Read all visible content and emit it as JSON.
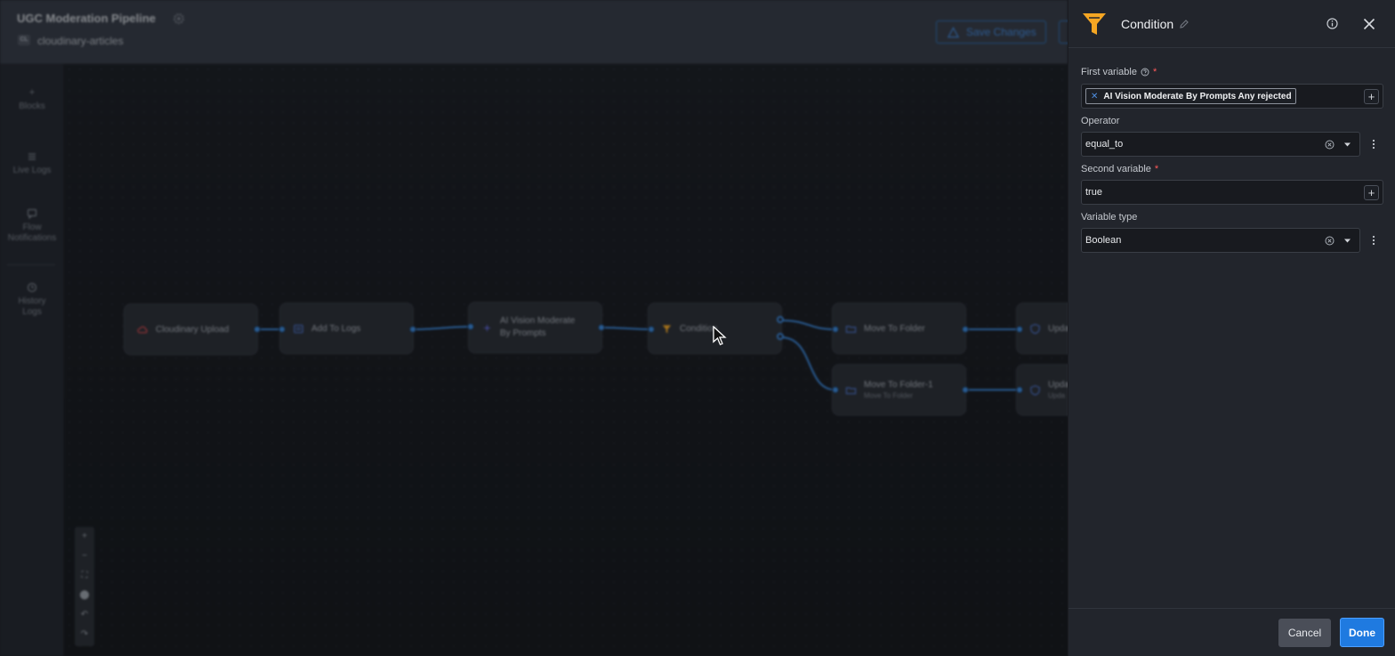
{
  "app": {
    "pipeline_title": "UGC Moderation Pipeline",
    "repo_badge": "CL",
    "repo_name": "cloudinary-articles",
    "save_changes_label": "Save Changes"
  },
  "leftnav": {
    "items": [
      {
        "label": "Blocks",
        "icon": "plus-icon"
      },
      {
        "label": "Live Logs",
        "icon": "list-icon"
      },
      {
        "label": "Flow Notifications",
        "icon": "message-icon"
      },
      {
        "label": "History Logs",
        "icon": "history-icon"
      }
    ]
  },
  "canvas": {
    "nodes": [
      {
        "title": "Cloudinary Upload",
        "sub": "",
        "icon": "cloud-icon"
      },
      {
        "title": "Add To Logs",
        "sub": "",
        "icon": "log-icon"
      },
      {
        "title": "AI Vision Moderate By Prompts",
        "sub": "",
        "icon": "sparkle-icon"
      },
      {
        "title": "Condition",
        "sub": "",
        "icon": "funnel-icon"
      },
      {
        "title": "Move To Folder",
        "sub": "",
        "icon": "folder-icon"
      },
      {
        "title": "Move To Folder-1",
        "sub": "Move To Folder",
        "icon": "folder-icon"
      },
      {
        "title": "Upda",
        "sub": "",
        "icon": "shield-icon"
      },
      {
        "title": "Upda",
        "sub": "Upda",
        "icon": "shield-icon"
      }
    ],
    "zoom_controls": [
      "+",
      "−",
      "⛶",
      "⬤",
      "↶",
      "↷"
    ]
  },
  "panel": {
    "title": "Condition",
    "first_variable": {
      "label": "First variable",
      "chip_text": "AI Vision Moderate By Prompts  Any rejected",
      "add_label": "+"
    },
    "operator": {
      "label": "Operator",
      "value": "equal_to"
    },
    "second_variable": {
      "label": "Second variable",
      "value": "true",
      "add_label": "+"
    },
    "variable_type": {
      "label": "Variable type",
      "value": "Boolean"
    },
    "required_mark": "*",
    "cancel_label": "Cancel",
    "done_label": "Done"
  },
  "colors": {
    "accent": "#1f7ae0",
    "edge": "#3a84d6",
    "condition_icon": "#f5a623",
    "required": "#ff5a5a"
  }
}
